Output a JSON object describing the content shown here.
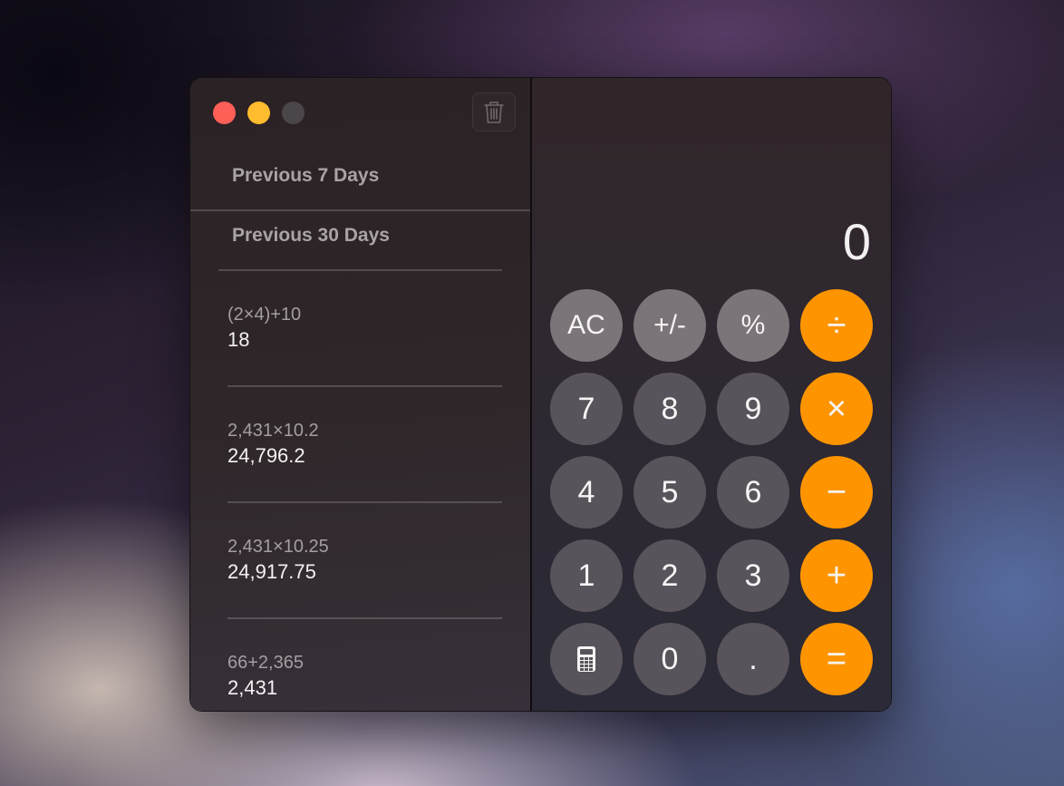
{
  "window": {
    "traffic_lights": [
      "close",
      "minimize",
      "zoom"
    ],
    "trash_icon": "trash-icon"
  },
  "sidebar": {
    "sections": [
      {
        "header": "Previous 7 Days"
      },
      {
        "header": "Previous 30 Days"
      }
    ],
    "history": [
      {
        "expression": "(2×4)+10",
        "result": "18"
      },
      {
        "expression": "2,431×10.2",
        "result": "24,796.2"
      },
      {
        "expression": "2,431×10.25",
        "result": "24,917.75"
      },
      {
        "expression": "66+2,365",
        "result": "2,431"
      }
    ]
  },
  "display": {
    "value": "0"
  },
  "keypad": {
    "rows": [
      [
        {
          "label": "AC",
          "type": "fn",
          "name": "all-clear"
        },
        {
          "label": "+/-",
          "type": "fn",
          "name": "sign-toggle"
        },
        {
          "label": "%",
          "type": "fn",
          "name": "percent"
        },
        {
          "label": "÷",
          "type": "op",
          "name": "divide"
        }
      ],
      [
        {
          "label": "7",
          "type": "num",
          "name": "digit-7"
        },
        {
          "label": "8",
          "type": "num",
          "name": "digit-8"
        },
        {
          "label": "9",
          "type": "num",
          "name": "digit-9"
        },
        {
          "label": "×",
          "type": "op",
          "name": "multiply"
        }
      ],
      [
        {
          "label": "4",
          "type": "num",
          "name": "digit-4"
        },
        {
          "label": "5",
          "type": "num",
          "name": "digit-5"
        },
        {
          "label": "6",
          "type": "num",
          "name": "digit-6"
        },
        {
          "label": "−",
          "type": "op",
          "name": "subtract"
        }
      ],
      [
        {
          "label": "1",
          "type": "num",
          "name": "digit-1"
        },
        {
          "label": "2",
          "type": "num",
          "name": "digit-2"
        },
        {
          "label": "3",
          "type": "num",
          "name": "digit-3"
        },
        {
          "label": "+",
          "type": "op",
          "name": "add"
        }
      ],
      [
        {
          "label": "calculator-icon",
          "type": "num",
          "name": "calculator-mode",
          "icon": true
        },
        {
          "label": "0",
          "type": "num",
          "name": "digit-0"
        },
        {
          "label": ".",
          "type": "num",
          "name": "decimal"
        },
        {
          "label": "=",
          "type": "op",
          "name": "equals"
        }
      ]
    ]
  },
  "colors": {
    "operator": "#fe9500",
    "function_key": "#7b7478",
    "number_key": "#59545b",
    "close": "#fe5f57",
    "minimize": "#febc2e",
    "zoom_disabled": "#4b4649"
  }
}
